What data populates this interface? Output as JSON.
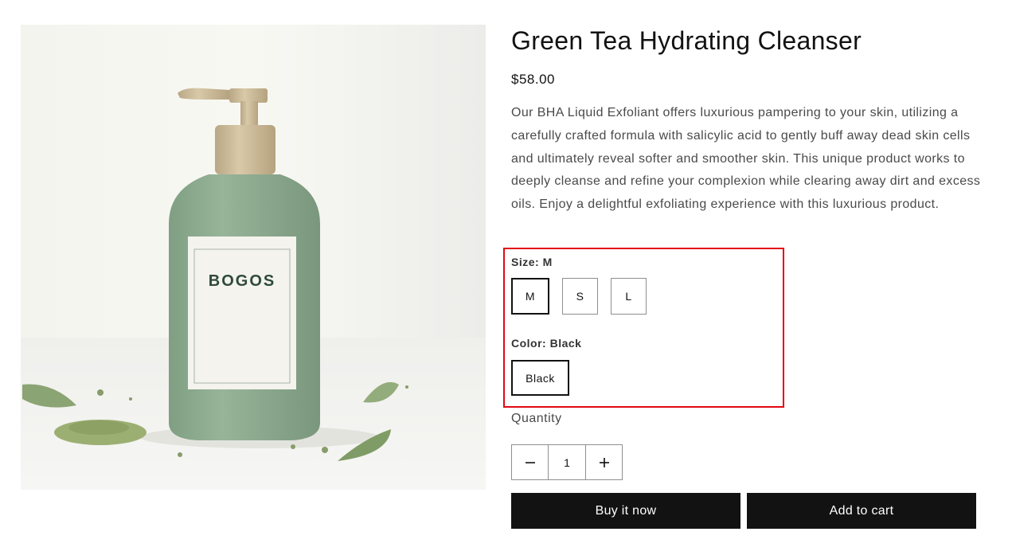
{
  "product": {
    "title": "Green Tea Hydrating Cleanser",
    "price": "$58.00",
    "description": "Our BHA Liquid Exfoliant offers luxurious pampering to your skin, utilizing a carefully crafted formula with salicylic acid to gently buff away dead skin cells and ultimately reveal softer and smoother skin. This unique product works to deeply cleanse and refine your complexion while clearing away dirt and excess oils. Enjoy a delightful exfoliating experience with this luxurious product.",
    "image_brand_text": "BOGOS"
  },
  "options": {
    "size": {
      "label": "Size:",
      "selected": "M",
      "values": [
        "M",
        "S",
        "L"
      ]
    },
    "color": {
      "label": "Color:",
      "selected": "Black",
      "values": [
        "Black"
      ]
    }
  },
  "quantity": {
    "label": "Quantity",
    "value": "1",
    "decrease_icon": "minus-icon",
    "increase_icon": "plus-icon"
  },
  "actions": {
    "buy_now": "Buy it now",
    "add_to_cart": "Add to cart"
  },
  "colors": {
    "highlight_border": "#e30613",
    "button_bg": "#121212",
    "button_text": "#ffffff",
    "bottle_green": "#8fae91",
    "bottle_cap": "#cdbb99"
  }
}
